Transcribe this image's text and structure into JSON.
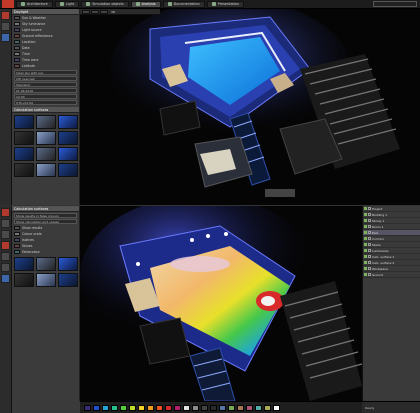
{
  "app": {
    "brand_color": "#c0392b"
  },
  "top_pane": {
    "menu_tabs": [
      "Architecture",
      "Light",
      "Simulation objects",
      "Analysis",
      "Documentation",
      "Presentation"
    ],
    "active_tab": 3,
    "search_placeholder": "",
    "props": {
      "header": "Daylight",
      "rows": [
        "Sun & Weather",
        "Sky luminance",
        "Light source",
        "Ground reflectance",
        "Location",
        "Date",
        "Time",
        "Time zone",
        "Latitude"
      ],
      "fields": [
        "Clear sky with sun",
        "CIE overcast",
        "Standard",
        "01.06.2016",
        "12:00",
        "UTC+01:00"
      ],
      "section_title": "Calculation surfaces",
      "thumbs_count": 12
    },
    "viewport_label": "3D"
  },
  "bottom_pane": {
    "props": {
      "header": "Calculation surfaces",
      "rows": [
        "Show results",
        "Colour scale",
        "Isolines",
        "Values",
        "Falsecolour"
      ],
      "fields": [
        "Show results in false colours",
        "Show calculation grid values"
      ],
      "thumbs_count": 6
    },
    "outliner": [
      {
        "label": "Project",
        "sel": false
      },
      {
        "label": "Building 1",
        "sel": false
      },
      {
        "label": "Storey 1",
        "sel": false
      },
      {
        "label": "Room 1",
        "sel": false
      },
      {
        "label": "Pool",
        "sel": true
      },
      {
        "label": "Corridor",
        "sel": false
      },
      {
        "label": "Stairs",
        "sel": false
      },
      {
        "label": "Luminaires",
        "sel": false
      },
      {
        "label": "Calc. surface 1",
        "sel": false
      },
      {
        "label": "Calc. surface 2",
        "sel": false
      },
      {
        "label": "Workplane",
        "sel": false
      },
      {
        "label": "Ground",
        "sel": false
      }
    ],
    "status": "Ready"
  },
  "palette_colors": [
    "#3b2a7a",
    "#1d4fd1",
    "#1fa6d6",
    "#24c28a",
    "#4fd13a",
    "#c2dc2a",
    "#f2d024",
    "#f29c1f",
    "#e8561c",
    "#d12a2a",
    "#b21f6a",
    "#e0e0e0",
    "#8a8a8a",
    "#444444",
    "#2a2a2a",
    "#5577aa",
    "#77aa55",
    "#aa7755",
    "#aa5577",
    "#55aaaa",
    "#aaaa55",
    "#ffffff"
  ]
}
